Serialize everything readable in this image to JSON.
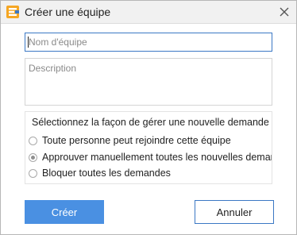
{
  "window": {
    "title": "Créer une équipe",
    "app_icon": "edraw-app-icon",
    "close_icon": "close-icon"
  },
  "form": {
    "name_placeholder": "Nom d'équipe",
    "name_value": "",
    "description_placeholder": "Description",
    "description_value": ""
  },
  "join_policy": {
    "title": "Sélectionnez la façon de gérer une nouvelle demande",
    "options": [
      {
        "label": "Toute personne peut rejoindre cette équipe",
        "selected": false
      },
      {
        "label": "Approuver manuellement toutes les nouvelles demandes",
        "selected": true
      },
      {
        "label": "Bloquer toutes les demandes",
        "selected": false
      }
    ]
  },
  "buttons": {
    "create_label": "Créer",
    "cancel_label": "Annuler"
  },
  "colors": {
    "primary": "#4a90e2",
    "focus_border": "#3b78c4",
    "titlebar_bg": "#f1f1f1"
  }
}
